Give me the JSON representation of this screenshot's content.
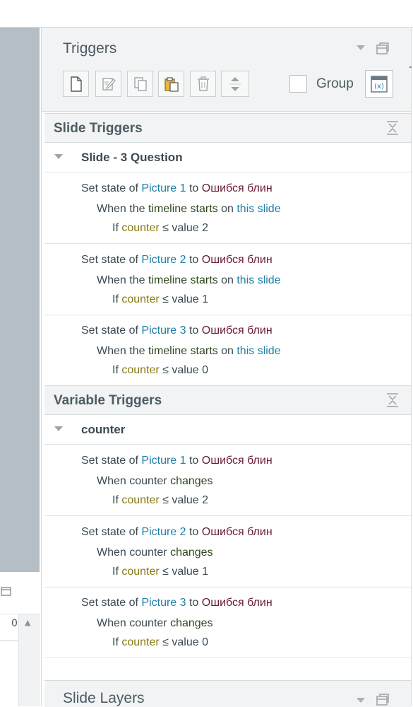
{
  "triggers_panel": {
    "title": "Triggers",
    "group_label": "Group",
    "toolbar": [
      {
        "icon": "new-trigger-icon"
      },
      {
        "icon": "edit-trigger-icon"
      },
      {
        "icon": "copy-icon"
      },
      {
        "icon": "paste-icon"
      },
      {
        "icon": "delete-icon"
      },
      {
        "icon": "move-up-down-icon"
      }
    ]
  },
  "slide_triggers": {
    "title": "Slide Triggers",
    "group_name": "Slide - 3 Question",
    "items": [
      {
        "p1": "Set state of",
        "object": "Picture 1",
        "p2": "to",
        "state": "Ошибся блин",
        "w1": "When the",
        "event": "timeline starts",
        "w2": "on",
        "target": "this slide",
        "c1": "If",
        "var": "counter",
        "cond": "≤ value 2"
      },
      {
        "p1": "Set state of",
        "object": "Picture 2",
        "p2": "to",
        "state": "Ошибся блин",
        "w1": "When the",
        "event": "timeline starts",
        "w2": "on",
        "target": "this slide",
        "c1": "If",
        "var": "counter",
        "cond": "≤ value 1"
      },
      {
        "p1": "Set state of",
        "object": "Picture 3",
        "p2": "to",
        "state": "Ошибся блин",
        "w1": "When the",
        "event": "timeline starts",
        "w2": "on",
        "target": "this slide",
        "c1": "If",
        "var": "counter",
        "cond": "≤ value 0"
      }
    ]
  },
  "variable_triggers": {
    "title": "Variable Triggers",
    "group_name": "counter",
    "items": [
      {
        "p1": "Set state of",
        "object": "Picture 1",
        "p2": "to",
        "state": "Ошибся блин",
        "w1": "When counter",
        "event": "changes",
        "c1": "If",
        "var": "counter",
        "cond": "≤ value 2"
      },
      {
        "p1": "Set state of",
        "object": "Picture 2",
        "p2": "to",
        "state": "Ошибся блин",
        "w1": "When counter",
        "event": "changes",
        "c1": "If",
        "var": "counter",
        "cond": "≤ value 1"
      },
      {
        "p1": "Set state of",
        "object": "Picture 3",
        "p2": "to",
        "state": "Ошибся блин",
        "w1": "When counter",
        "event": "changes",
        "c1": "If",
        "var": "counter",
        "cond": "≤ value 0"
      }
    ]
  },
  "slide_layers": {
    "title": "Slide Layers"
  },
  "timeline": {
    "zero_label": "0"
  },
  "colors": {
    "object": "#1f7fa8",
    "state": "#6a1a3a",
    "event": "#2f4a1e",
    "variable": "#8a7a12",
    "header_bg": "#f1f3f4"
  }
}
